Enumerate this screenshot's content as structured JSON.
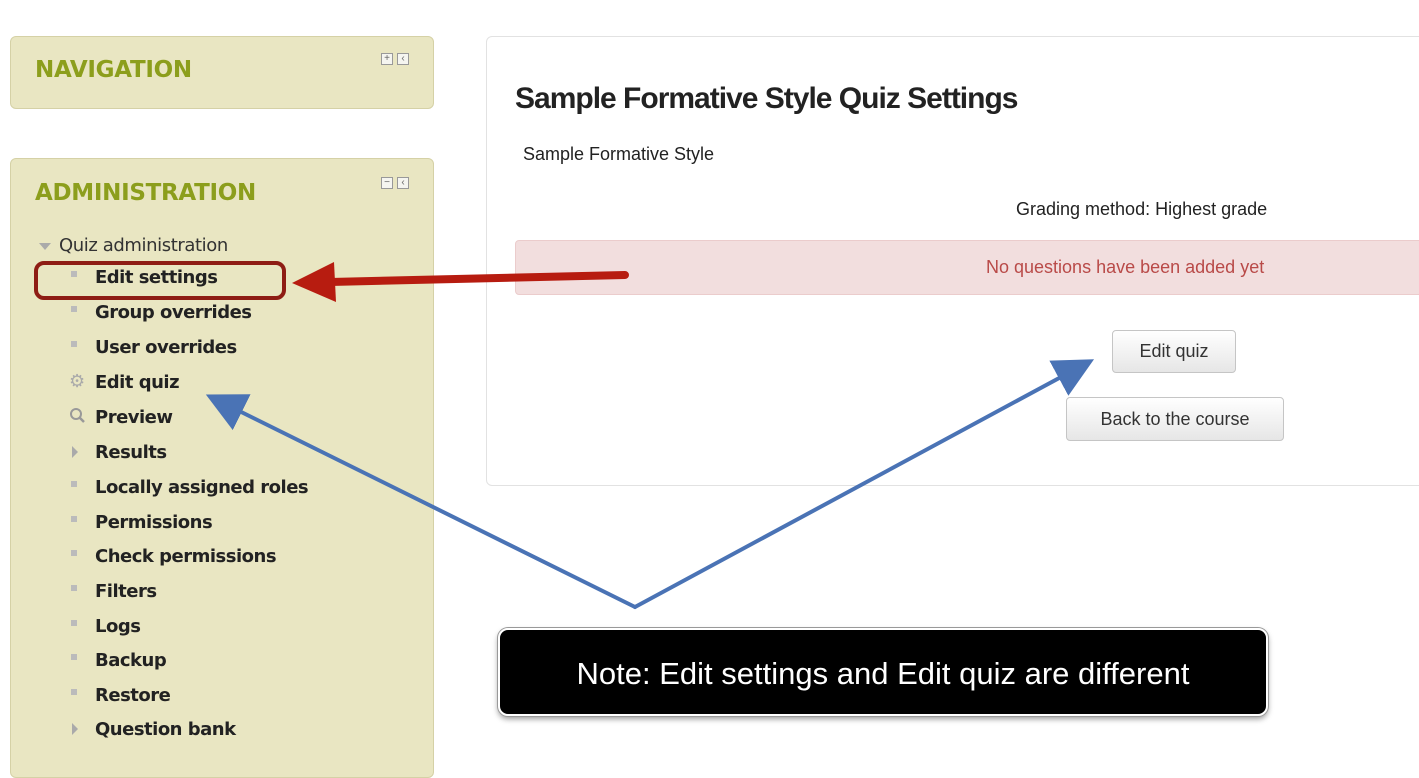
{
  "navigation_block": {
    "title": "NAVIGATION",
    "controls": [
      {
        "icon": "plus-icon",
        "glyph": "+"
      },
      {
        "icon": "dock-icon",
        "glyph": "‹"
      }
    ]
  },
  "administration_block": {
    "title": "ADMINISTRATION",
    "controls": [
      {
        "icon": "minus-icon",
        "glyph": "−"
      },
      {
        "icon": "dock-icon",
        "glyph": "‹"
      }
    ],
    "tree_root": "Quiz administration",
    "items": [
      {
        "label": "Edit settings",
        "icon": "bullet-icon"
      },
      {
        "label": "Group overrides",
        "icon": "bullet-icon"
      },
      {
        "label": "User overrides",
        "icon": "bullet-icon"
      },
      {
        "label": "Edit quiz",
        "icon": "gear-icon"
      },
      {
        "label": "Preview",
        "icon": "search-icon"
      },
      {
        "label": "Results",
        "icon": "expand-icon"
      },
      {
        "label": "Locally assigned roles",
        "icon": "bullet-icon"
      },
      {
        "label": "Permissions",
        "icon": "bullet-icon"
      },
      {
        "label": "Check permissions",
        "icon": "bullet-icon"
      },
      {
        "label": "Filters",
        "icon": "bullet-icon"
      },
      {
        "label": "Logs",
        "icon": "bullet-icon"
      },
      {
        "label": "Backup",
        "icon": "bullet-icon"
      },
      {
        "label": "Restore",
        "icon": "bullet-icon"
      },
      {
        "label": "Question bank",
        "icon": "expand-icon"
      }
    ]
  },
  "main": {
    "title": "Sample Formative Style Quiz Settings",
    "intro": "Sample Formative Style",
    "grading_method": "Grading method: Highest grade",
    "alert": "No questions have been added yet",
    "edit_quiz_button": "Edit quiz",
    "back_button": "Back to the course"
  },
  "annotation": {
    "callout_text": "Note: Edit settings and Edit quiz are different",
    "highlight_target": "Edit settings",
    "colors": {
      "red_arrow": "#b71c10",
      "blue_arrow": "#4a73b5",
      "highlight": "#8e1d14"
    }
  }
}
